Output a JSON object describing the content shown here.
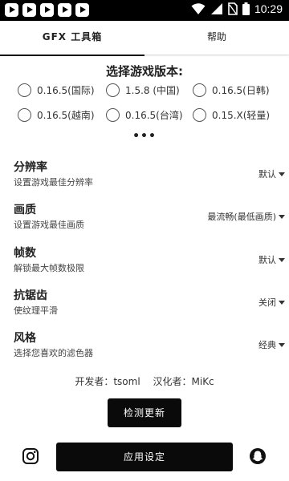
{
  "status_bar": {
    "time": "10:29",
    "app_icons": [
      "app-icon",
      "app-icon",
      "app-icon",
      "app-icon",
      "app-icon"
    ],
    "right_icons": [
      "wifi-icon",
      "signal-icon",
      "no-sim-icon",
      "battery-icon"
    ]
  },
  "tabs": [
    {
      "label": "GFX 工具箱",
      "active": true
    },
    {
      "label": "帮助",
      "active": false
    }
  ],
  "version": {
    "title": "选择游戏版本:",
    "options_row1": [
      "0.16.5(国际)",
      "1.5.8 (中国)",
      "0.16.5(日韩)"
    ],
    "options_row2": [
      "0.16.5(越南)",
      "0.16.5(台湾)",
      "0.15.X(轻量)"
    ],
    "more": "•••"
  },
  "settings": [
    {
      "title": "分辨率",
      "desc": "设置游戏最佳分辨率",
      "value": "默认"
    },
    {
      "title": "画质",
      "desc": "设置游戏最佳画质",
      "value": "最流畅(最低画质)"
    },
    {
      "title": "帧数",
      "desc": "解锁最大帧数极限",
      "value": "默认"
    },
    {
      "title": "抗锯齿",
      "desc": "使纹理平滑",
      "value": "关闭"
    },
    {
      "title": "风格",
      "desc": "选择您喜欢的滤色器",
      "value": "经典"
    }
  ],
  "credits": {
    "developer": "开发者：tsoml",
    "translator": "汉化者：MiKc"
  },
  "buttons": {
    "check_update": "检测更新",
    "apply": "应用设定"
  },
  "footer_icons": [
    "instagram-icon",
    "snapchat-icon"
  ]
}
